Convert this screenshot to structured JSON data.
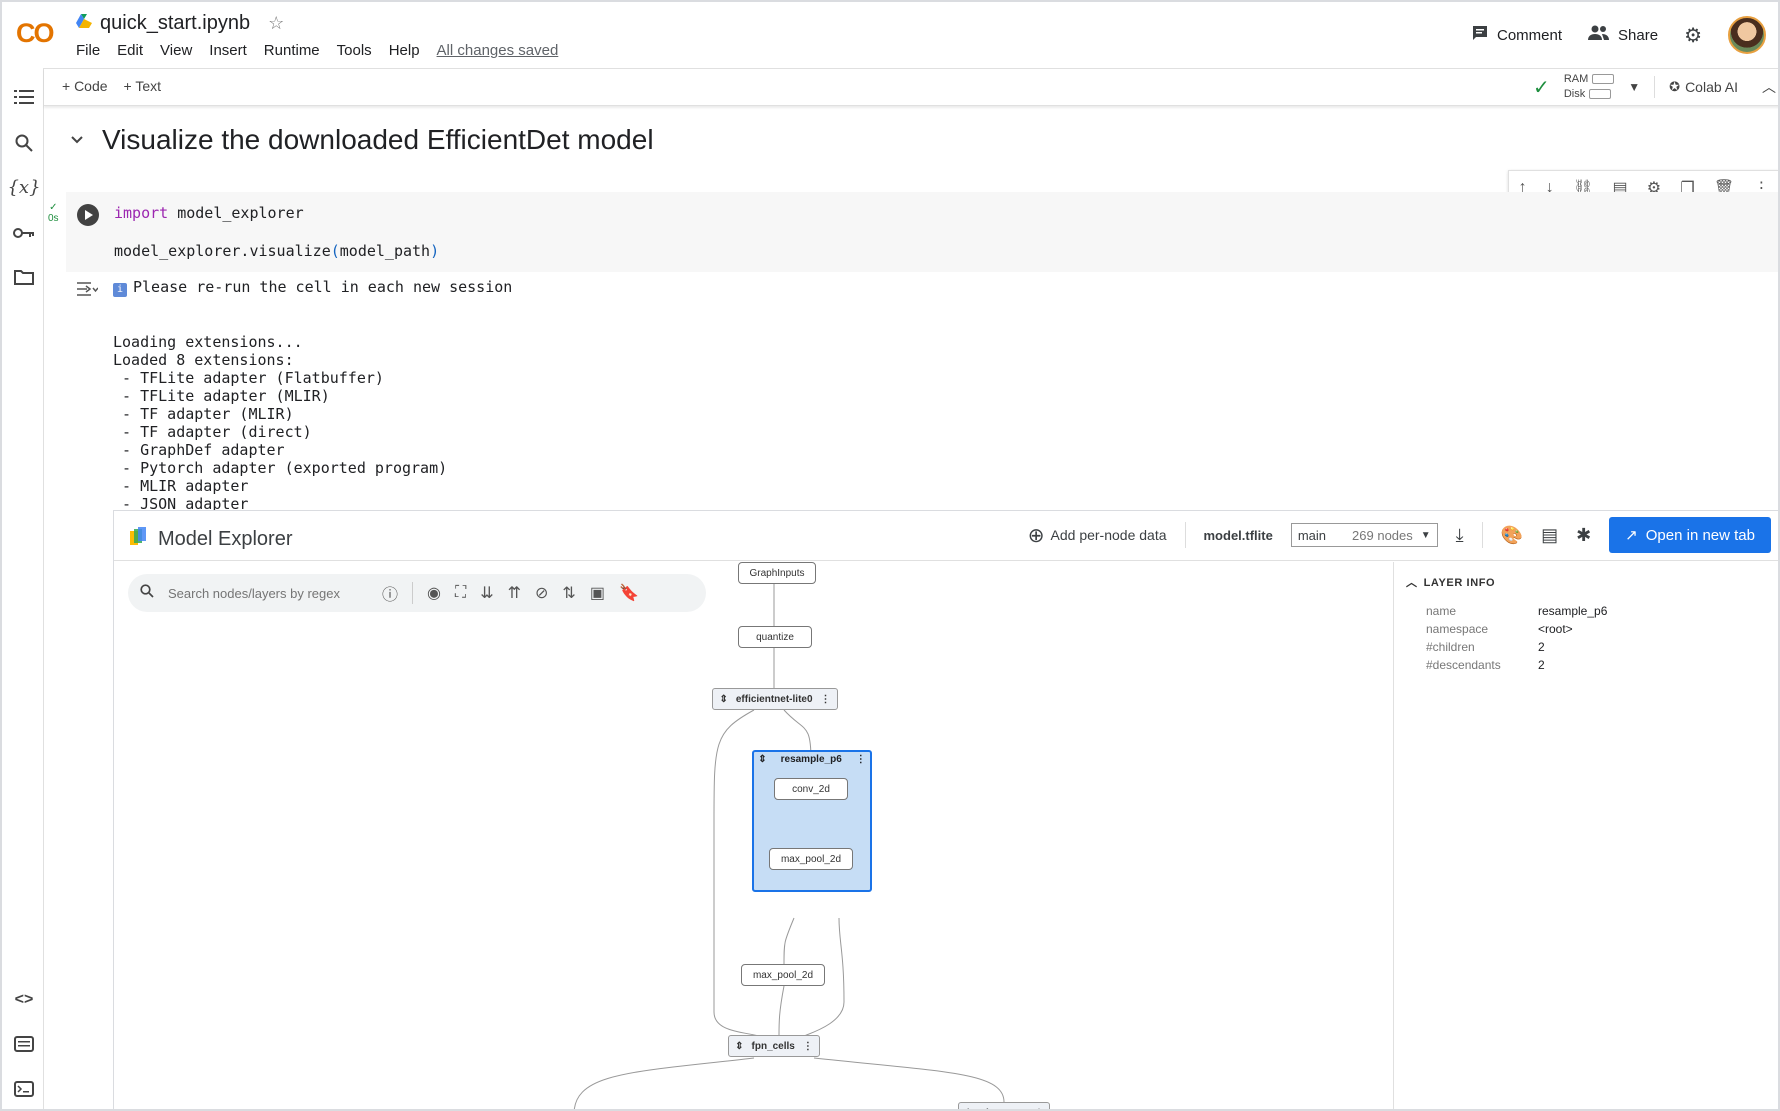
{
  "app": {
    "logo": "CO",
    "filename": "quick_start.ipynb",
    "save_status": "All changes saved"
  },
  "menu": [
    "File",
    "Edit",
    "View",
    "Insert",
    "Runtime",
    "Tools",
    "Help"
  ],
  "header_actions": {
    "comment": "Comment",
    "share": "Share"
  },
  "toolbar": {
    "add_code": "+ Code",
    "add_text": "+ Text",
    "ram": "RAM",
    "disk": "Disk",
    "colab_ai": "Colab AI"
  },
  "section": {
    "heading": "Visualize the downloaded EfficientDet model"
  },
  "cell": {
    "exec_time": "0s",
    "line1_kw": "import",
    "line1_rest": " model_explorer",
    "line2_a": "model_explorer.visualize",
    "line2_b": "(",
    "line2_c": "model_path",
    "line2_d": ")"
  },
  "output": {
    "notice": "Please re-run the cell in each new session",
    "lines": [
      "Loading extensions...",
      "Loaded 8 extensions:",
      " - TFLite adapter (Flatbuffer)",
      " - TFLite adapter (MLIR)",
      " - TF adapter (MLIR)",
      " - TF adapter (direct)",
      " - GraphDef adapter",
      " - Pytorch adapter (exported program)",
      " - MLIR adapter",
      " - JSON adapter"
    ]
  },
  "model_explorer": {
    "title": "Model Explorer",
    "add_data": "Add per-node data",
    "model_file": "model.tflite",
    "graph_select": "main",
    "node_count": "269 nodes",
    "open_btn": "Open in new tab",
    "search_placeholder": "Search nodes/layers by regex",
    "nodes": {
      "graph_inputs": "GraphInputs",
      "quantize": "quantize",
      "efficientnet": "efficientnet-lite0",
      "resample": "resample_p6",
      "conv": "conv_2d",
      "maxpool_inner": "max_pool_2d",
      "maxpool_outer": "max_pool_2d",
      "fpn": "fpn_cells",
      "class_net": "class_net"
    },
    "layer_info": {
      "title": "LAYER INFO",
      "rows": [
        {
          "k": "name",
          "v": "resample_p6"
        },
        {
          "k": "namespace",
          "v": "<root>"
        },
        {
          "k": "#children",
          "v": "2"
        },
        {
          "k": "#descendants",
          "v": "2"
        }
      ]
    }
  }
}
